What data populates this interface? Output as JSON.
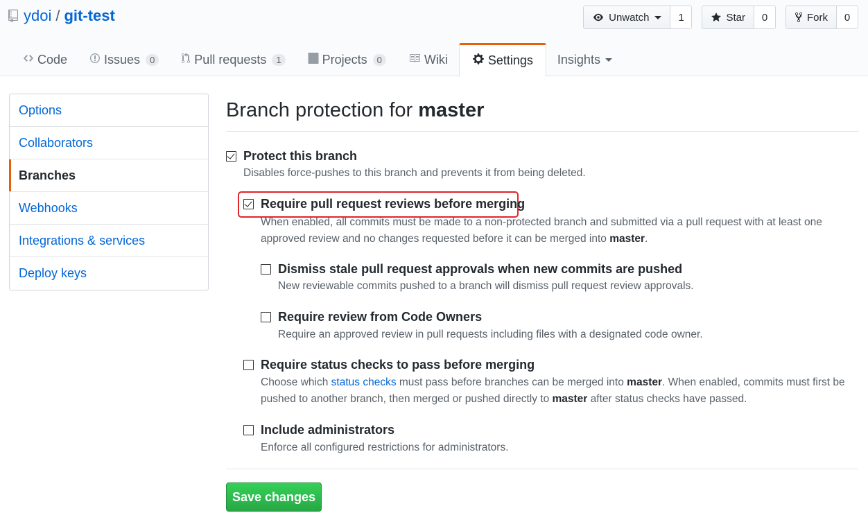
{
  "repo": {
    "owner": "ydoi",
    "separator": "/",
    "name": "git-test"
  },
  "actions": {
    "watch_label": "Unwatch",
    "watch_count": "1",
    "star_label": "Star",
    "star_count": "0",
    "fork_label": "Fork",
    "fork_count": "0"
  },
  "tabs": {
    "code": "Code",
    "issues": "Issues",
    "issues_count": "0",
    "pulls": "Pull requests",
    "pulls_count": "1",
    "projects": "Projects",
    "projects_count": "0",
    "wiki": "Wiki",
    "settings": "Settings",
    "insights": "Insights"
  },
  "sidebar": {
    "items": [
      {
        "label": "Options"
      },
      {
        "label": "Collaborators"
      },
      {
        "label": "Branches"
      },
      {
        "label": "Webhooks"
      },
      {
        "label": "Integrations & services"
      },
      {
        "label": "Deploy keys"
      }
    ]
  },
  "main": {
    "heading_prefix": "Branch protection for",
    "heading_branch": "master",
    "protect": {
      "label": "Protect this branch",
      "note": "Disables force-pushes to this branch and prevents it from being deleted.",
      "checked": true
    },
    "require_reviews": {
      "label": "Require pull request reviews before merging",
      "note_a": "When enabled, all commits must be made to a non-protected branch and submitted via a pull request with at least one approved review and no changes requested before it can be merged into",
      "note_branch": "master",
      "note_end": ".",
      "checked": true
    },
    "dismiss_stale": {
      "label": "Dismiss stale pull request approvals when new commits are pushed",
      "note": "New reviewable commits pushed to a branch will dismiss pull request review approvals.",
      "checked": false
    },
    "code_owners": {
      "label": "Require review from Code Owners",
      "note": "Require an approved review in pull requests including files with a designated code owner.",
      "checked": false
    },
    "status_checks": {
      "label": "Require status checks to pass before merging",
      "note_a": "Choose which",
      "note_link": "status checks",
      "note_b": "must pass before branches can be merged into",
      "note_branch1": "master",
      "note_c": ". When enabled, commits must first be pushed to another branch, then merged or pushed directly to",
      "note_branch2": "master",
      "note_d": "after status checks have passed.",
      "checked": false
    },
    "admins": {
      "label": "Include administrators",
      "note": "Enforce all configured restrictions for administrators.",
      "checked": false
    },
    "save_label": "Save changes"
  },
  "colors": {
    "link": "#0366d6",
    "accent": "#e36209",
    "highlight": "#e0242b",
    "save_green": "#28a745"
  }
}
